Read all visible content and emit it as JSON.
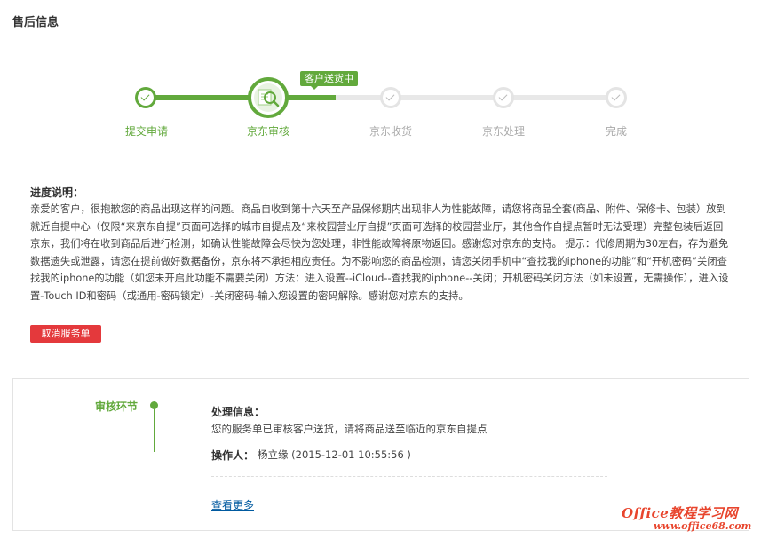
{
  "page": {
    "title": "售后信息"
  },
  "progress": {
    "status_tag": "客户送货中",
    "steps": [
      {
        "label": "提交申请",
        "state": "done"
      },
      {
        "label": "京东审核",
        "state": "current"
      },
      {
        "label": "京东收货",
        "state": "pending"
      },
      {
        "label": "京东处理",
        "state": "pending"
      },
      {
        "label": "完成",
        "state": "pending"
      }
    ],
    "colors": {
      "done": "#62a93c",
      "pending": "#e4e4e4"
    }
  },
  "description": {
    "title": "进度说明：",
    "body": "亲爱的客户，很抱歉您的商品出现这样的问题。商品自收到第十六天至产品保修期内出现非人为性能故障，请您将商品全套(商品、附件、保修卡、包装）放到就近自提中心（仅限“来京东自提”页面可选择的城市自提点及“来校园营业厅自提”页面可选择的校园营业厅，其他合作自提点暂时无法受理）完整包装后返回京东，我们将在收到商品后进行检测，如确认性能故障会尽快为您处理，非性能故障将原物返回。感谢您对京东的支持。 提示：代修周期为30左右，存为避免数据遗失或泄露，请您在提前做好数据备份，京东将不承担相应责任。为不影响您的商品检测，请您关闭手机中“查找我的iphone的功能”和“开机密码”关闭查找我的iphone的功能（如您未开启此功能不需要关闭）方法：进入设置--iCloud--查找我的iphone--关闭；开机密码关闭方法（如未设置，无需操作），进入设置-Touch ID和密码（或通用-密码锁定）-关闭密码-输入您设置的密码解除。感谢您对京东的支持。"
  },
  "actions": {
    "cancel_label": "取消服务单",
    "cancel_color": "#e4393c"
  },
  "audit": {
    "stage_label": "审核环节",
    "process_title": "处理信息：",
    "process_text": "您的服务单已审核客户送货，请将商品送至临近的京东自提点",
    "operator_label": "操作人：",
    "operator_value": "杨立缘 (2015-12-01 10:55:56 )",
    "more_link": "查看更多"
  },
  "watermark": {
    "line1": "Office教程学习网",
    "line2": "www.office68.com"
  }
}
